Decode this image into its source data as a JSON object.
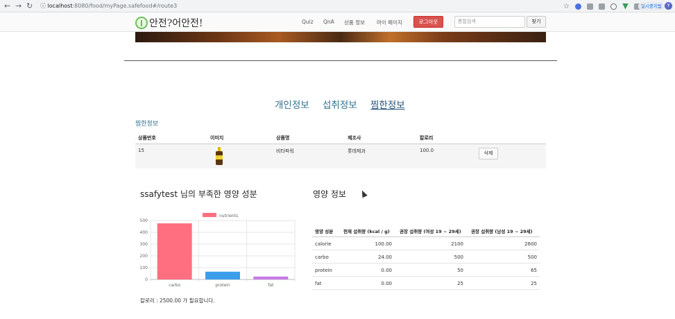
{
  "browser": {
    "back_icon": "arrow-left-icon",
    "forward_icon": "arrow-right-icon",
    "reload_icon": "reload-icon",
    "url_host": "localhost",
    "url_path": ":8080/food/myPage.safefood#/route3",
    "profile_label": "일시중지됨",
    "avatar_letter": "Y"
  },
  "header": {
    "logo_text": "안전?어안전!",
    "menu": [
      "Quiz",
      "QnA",
      "상품 정보",
      "마이 페이지"
    ],
    "logout_label": "로그아웃",
    "search_placeholder": "통합검색",
    "search_button": "찾기"
  },
  "tabs": [
    "개인정보",
    "섭취정보",
    "찜한정보"
  ],
  "favorites": {
    "title": "찜한정보",
    "columns": [
      "상품번호",
      "이미지",
      "상품명",
      "제조사",
      "칼로리"
    ],
    "rows": [
      {
        "id": "15",
        "name": "비타파워",
        "maker": "롯데제과",
        "calorie": "100.0",
        "delete_label": "삭제"
      }
    ]
  },
  "deficit": {
    "heading": "ssafytest 님의 부족한 영양 성분",
    "calorie_note": "칼로리 : 2500.00 가 필요합니다."
  },
  "chart_data": {
    "type": "bar",
    "legend": "nutrients",
    "legend_color": "#ff6f7f",
    "categories": [
      "carbo",
      "protein",
      "fat"
    ],
    "values": [
      476,
      66,
      25
    ],
    "colors": [
      "#ff6f7f",
      "#3a9eea",
      "#c77be8"
    ],
    "ylim": [
      0,
      500
    ],
    "yticks": [
      "500",
      "400",
      "300",
      "200",
      "100",
      "0"
    ],
    "grid": true
  },
  "nutrition": {
    "heading": "영양 정보",
    "columns": [
      "영양 성분",
      "현재 섭취량 (kcal / g)",
      "권장 섭취량 (여성 19 ~ 29세)",
      "권장 섭취량 (남성 19 ~ 29세)"
    ],
    "rows": [
      [
        "calorie",
        "100.00",
        "2100",
        "2600"
      ],
      [
        "carbo",
        "24.00",
        "500",
        "500"
      ],
      [
        "protein",
        "0.00",
        "50",
        "65"
      ],
      [
        "fat",
        "0.00",
        "25",
        "25"
      ]
    ]
  }
}
